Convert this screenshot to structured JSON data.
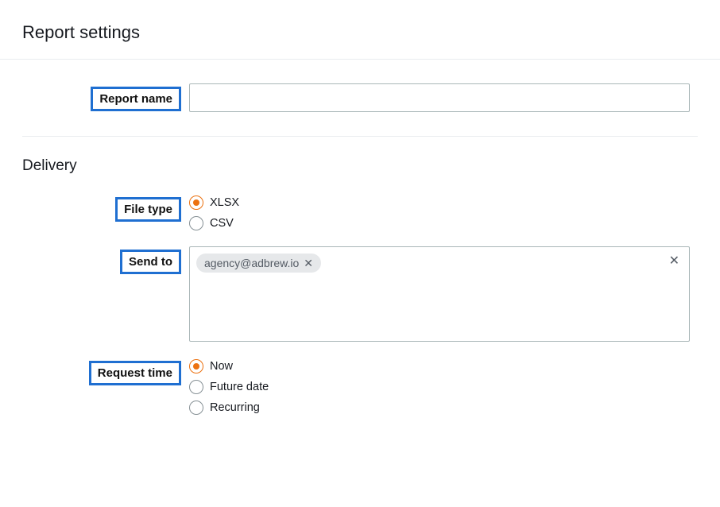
{
  "page_title": "Report settings",
  "report_name": {
    "label": "Report name",
    "value": ""
  },
  "delivery": {
    "heading": "Delivery",
    "file_type": {
      "label": "File type",
      "options": [
        {
          "value": "xlsx",
          "label": "XLSX",
          "selected": true
        },
        {
          "value": "csv",
          "label": "CSV",
          "selected": false
        }
      ]
    },
    "send_to": {
      "label": "Send to",
      "recipients": [
        "agency@adbrew.io"
      ]
    },
    "request_time": {
      "label": "Request time",
      "options": [
        {
          "value": "now",
          "label": "Now",
          "selected": true
        },
        {
          "value": "future",
          "label": "Future date",
          "selected": false
        },
        {
          "value": "recurring",
          "label": "Recurring",
          "selected": false
        }
      ]
    }
  }
}
